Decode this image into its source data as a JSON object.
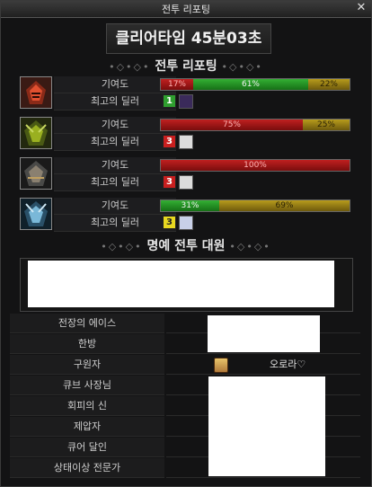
{
  "window": {
    "title": "전투 리포팅",
    "close_label": "✕"
  },
  "banner": {
    "text": "클리어타임  45분03초"
  },
  "report_title": "전투 리포팅",
  "honor_title": "명예 전투 대원",
  "labels": {
    "contribution": "기여도",
    "best_dealer": "최고의 딜러"
  },
  "parties": [
    {
      "color": "#e05030",
      "segments": [
        {
          "style": "red",
          "pct": 17,
          "label": "17%"
        },
        {
          "style": "green",
          "pct": 61,
          "label": "61%"
        },
        {
          "style": "gold",
          "pct": 22,
          "label": "22%"
        }
      ],
      "dealer_badge": {
        "text": "1",
        "style": "green"
      }
    },
    {
      "color": "#9ab020",
      "segments": [
        {
          "style": "red",
          "pct": 75,
          "label": "75%"
        },
        {
          "style": "gold",
          "pct": 25,
          "label": "25%"
        }
      ],
      "dealer_badge": {
        "text": "3",
        "style": "red"
      }
    },
    {
      "color": "#c0a060",
      "segments": [
        {
          "style": "red",
          "pct": 100,
          "label": "100%"
        }
      ],
      "dealer_badge": {
        "text": "3",
        "style": "red"
      }
    },
    {
      "color": "#3aa0d0",
      "segments": [
        {
          "style": "green",
          "pct": 31,
          "label": "31%"
        },
        {
          "style": "gold",
          "pct": 69,
          "label": "69%"
        }
      ],
      "dealer_badge": {
        "text": "3",
        "style": "yellow"
      }
    }
  ],
  "awards": [
    {
      "name": "전장의 에이스",
      "value": ""
    },
    {
      "name": "한방",
      "value": ""
    },
    {
      "name": "구원자",
      "value": "오로라♡"
    },
    {
      "name": "큐브 사장님",
      "value": ""
    },
    {
      "name": "회피의 신",
      "value": ""
    },
    {
      "name": "제압자",
      "value": ""
    },
    {
      "name": "큐어 달인",
      "value": ""
    },
    {
      "name": "상태이상 전문가",
      "value": ""
    }
  ]
}
